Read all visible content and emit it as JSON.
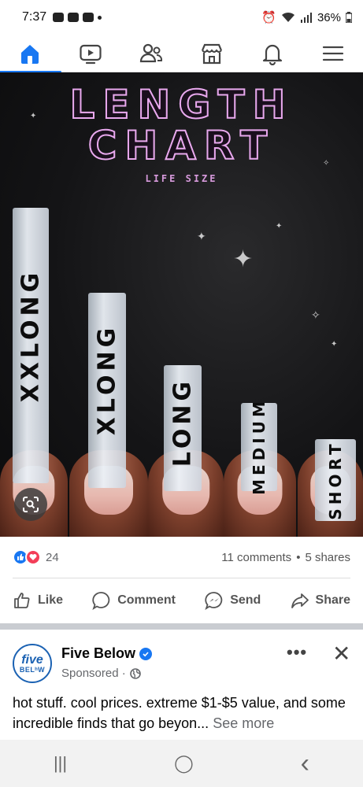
{
  "status_bar": {
    "time": "7:37",
    "battery": "36%"
  },
  "nav": {
    "items": [
      {
        "name": "home",
        "icon": "home-icon",
        "active": true
      },
      {
        "name": "watch",
        "icon": "video-icon",
        "active": false
      },
      {
        "name": "friends",
        "icon": "friends-icon",
        "active": false
      },
      {
        "name": "marketplace",
        "icon": "marketplace-icon",
        "active": false
      },
      {
        "name": "notifications",
        "icon": "bell-icon",
        "active": false
      },
      {
        "name": "menu",
        "icon": "hamburger-icon",
        "active": false
      }
    ],
    "accent": "#1877f2"
  },
  "post_image": {
    "title_line1": "LENGTH",
    "title_line2": "CHART",
    "subtitle": "LIFE SIZE",
    "nails": [
      "XXLONG",
      "XLONG",
      "LONG",
      "MEDIUM",
      "SHORT"
    ]
  },
  "reactions": {
    "count": "24",
    "comments": "11 comments",
    "separator": "•",
    "shares": "5 shares"
  },
  "actions": {
    "like": "Like",
    "comment": "Comment",
    "send": "Send",
    "share": "Share"
  },
  "sponsored_post": {
    "avatar_line1": "five",
    "avatar_line2": "BELʰW",
    "name": "Five Below",
    "meta": "Sponsored ·",
    "more": "•••",
    "close": "✕",
    "text": "hot stuff. cool prices. extreme $1-$5 value, and some incredible finds that go beyon...",
    "see_more": "See more"
  },
  "android_nav": {
    "recents": "|||",
    "home": "◯",
    "back": "‹"
  }
}
